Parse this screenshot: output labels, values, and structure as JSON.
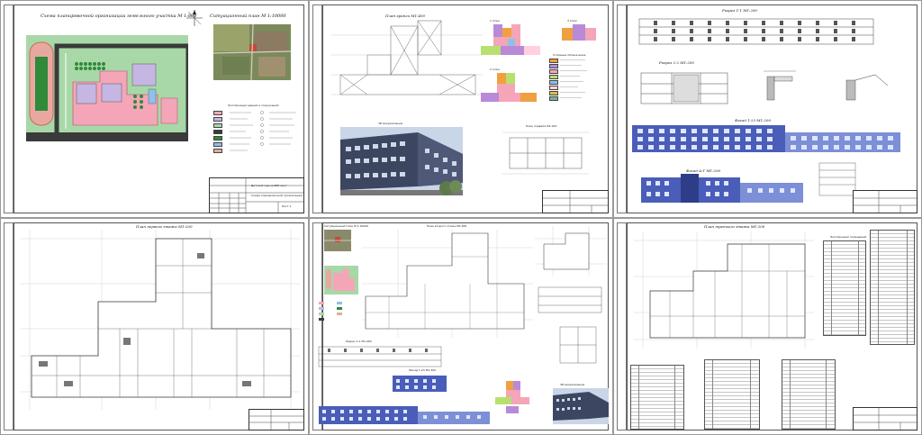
{
  "sheets": [
    {
      "title": "Схема планировочной организации земельного участка  М 1:800",
      "secondary_title": "Ситуационный план  М 1:10000",
      "legend_title": "Экспликация зданий и сооружений",
      "stamp_lines": [
        "Детский сад на 280 мест",
        "Схема планировочной организации",
        "Лист 1"
      ]
    },
    {
      "title": "План кровли  М1:400",
      "floor_labels": [
        "1 этаж",
        "2 этаж",
        "3 этаж"
      ],
      "legend_title": "Условные обозначения",
      "render_caption": "3D визуализация",
      "basement_caption": "План подвала  М1:200"
    },
    {
      "section_1": "Разрез 1-1  М1:200",
      "section_2": "Разрез 2-2  М1:200",
      "facade_1": "Фасад 1-23  М1:200",
      "facade_2": "Фасад А-Г  М1:200"
    },
    {
      "title": "План первого этажа  М1:200"
    },
    {
      "situ_caption": "Ситуационный план  М 1:10000",
      "plan_caption": "План второго этажа  М1:400",
      "section_caption": "Разрез 1-1  М1:400",
      "facade_caption": "Фасад 1-23  М1:400",
      "render_caption": "3D визуализация"
    },
    {
      "title": "План третьего этажа  М1:200",
      "table_title": "Экспликация помещений"
    }
  ],
  "colors": {
    "site_green": "#a8d8a8",
    "building_pink": "#f4a6b8",
    "road_gray": "#3a3a3a",
    "field_green": "#2f8a3a",
    "facade_blue": "#4a5db8",
    "facade_light": "#7d8fd6",
    "zone_orange": "#f0a040",
    "zone_purple": "#b98ad8",
    "zone_lime": "#b8e070",
    "render_sky": "#c9d6e8",
    "render_wall": "#3d4660"
  }
}
